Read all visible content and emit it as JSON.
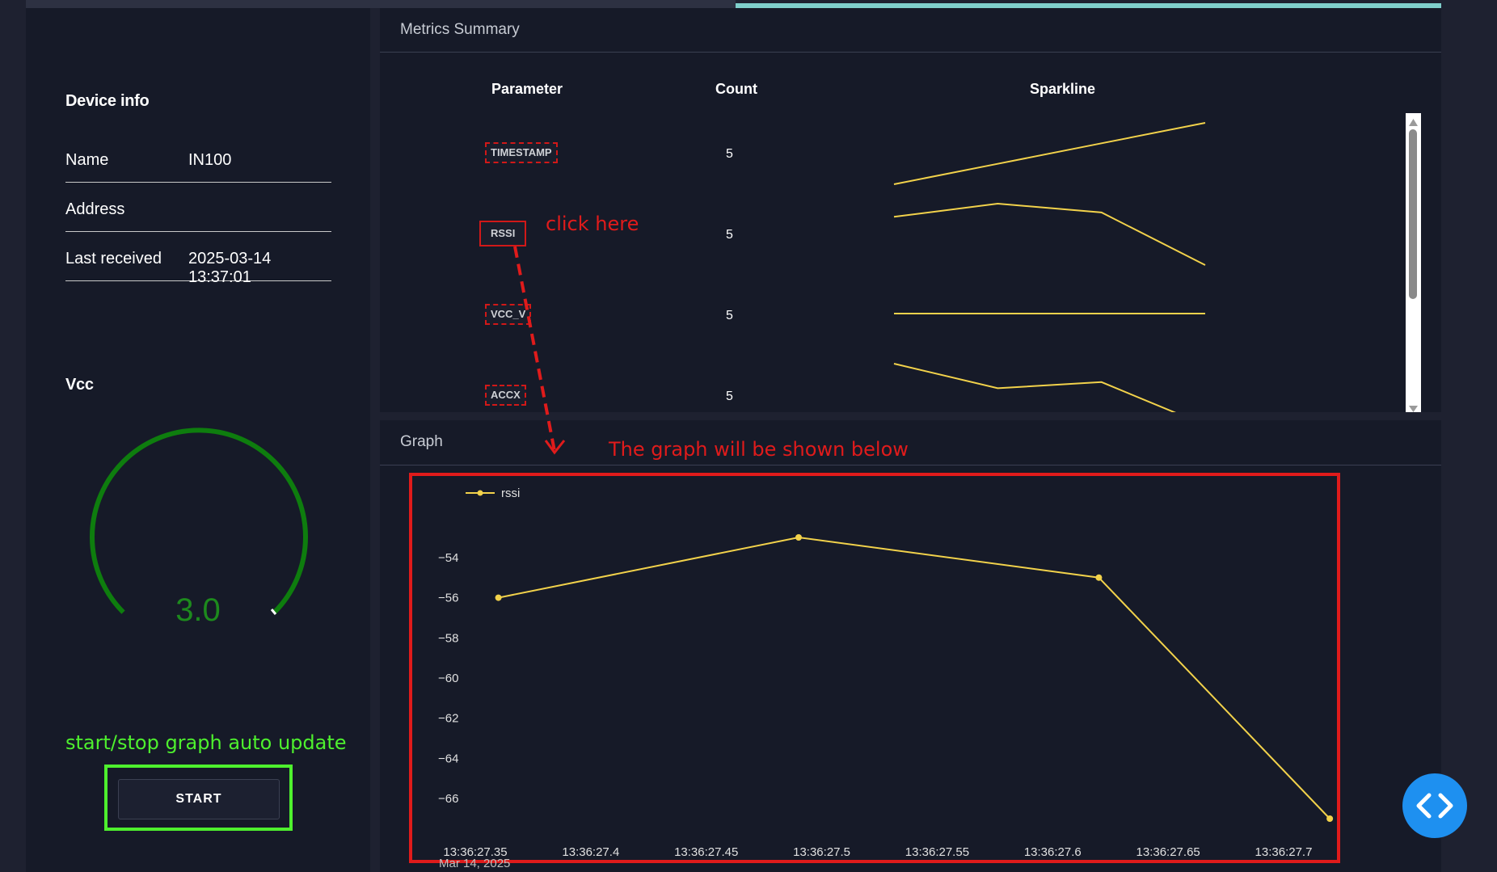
{
  "device_info": {
    "heading": "Device info",
    "rows": [
      {
        "label": "Name",
        "value": "IN100"
      },
      {
        "label": "Address",
        "value": ""
      },
      {
        "label": "Last received",
        "value": "2025-03-14 13:37:01"
      }
    ]
  },
  "vcc": {
    "heading": "Vcc",
    "value": "3.0",
    "color": "#1d8a1d"
  },
  "controls": {
    "start_label": "START",
    "annotation": "start/stop graph auto update",
    "annotation_color": "#4ef02e"
  },
  "metrics": {
    "title": "Metrics Summary",
    "columns": [
      "Parameter",
      "Count",
      "Sparkline"
    ],
    "rows": [
      {
        "parameter": "TIMESTAMP",
        "count": "5",
        "spark": [
          0,
          1,
          2,
          3
        ]
      },
      {
        "parameter": "RSSI",
        "count": "5",
        "spark": [
          -56,
          -53,
          -55,
          -67
        ]
      },
      {
        "parameter": "VCC_V",
        "count": "5",
        "spark": [
          3.0,
          3.0,
          3.0,
          3.0
        ]
      },
      {
        "parameter": "ACCX",
        "count": "5",
        "spark": [
          3,
          1,
          1.5,
          -2
        ]
      }
    ],
    "annotation": "click here",
    "line_color": "#f2d24b"
  },
  "graph": {
    "title": "Graph",
    "annotation": "The graph will be shown below",
    "date_label": "Mar 14, 2025",
    "annotation_color": "#e01b1b"
  },
  "chart_data": {
    "type": "line",
    "series": [
      {
        "name": "rssi",
        "x": [
          "13:36:27.36",
          "13:36:27.49",
          "13:36:27.62",
          "13:36:27.72"
        ],
        "y": [
          -56,
          -53,
          -55,
          -67
        ]
      }
    ],
    "x_ticks": [
      "13:36:27.35",
      "13:36:27.4",
      "13:36:27.45",
      "13:36:27.5",
      "13:36:27.55",
      "13:36:27.6",
      "13:36:27.65",
      "13:36:27.7"
    ],
    "y_ticks": [
      "−54",
      "−56",
      "−58",
      "−60",
      "−62",
      "−64",
      "−66"
    ],
    "ylim": [
      -67,
      -53
    ],
    "legend_position": "top-left",
    "color": "#f2d24b"
  }
}
